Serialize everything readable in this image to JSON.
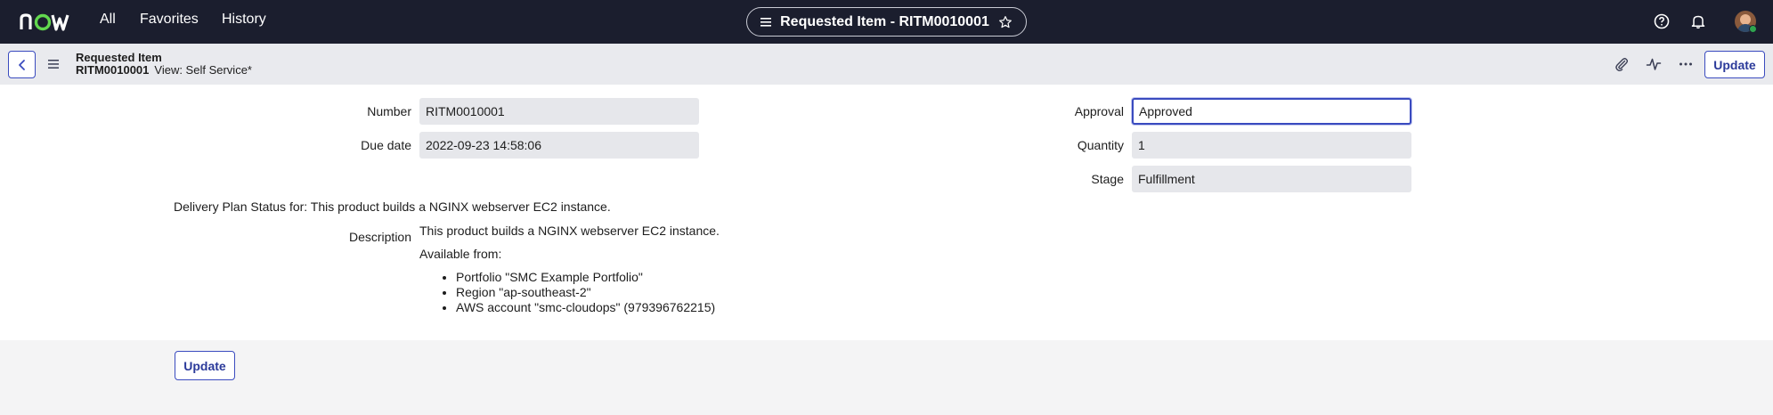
{
  "nav": {
    "links": {
      "all": "All",
      "favorites": "Favorites",
      "history": "History"
    },
    "center_title": "Requested Item - RITM0010001",
    "icons": [
      "help-icon",
      "bell-icon",
      "avatar"
    ]
  },
  "form_header": {
    "type": "Requested Item",
    "number": "RITM0010001",
    "view": "View: Self Service*",
    "update_label": "Update",
    "icons": [
      "paperclip-icon",
      "activity-icon",
      "more-icon"
    ]
  },
  "fields": {
    "number": {
      "label": "Number",
      "value": "RITM0010001"
    },
    "due_date": {
      "label": "Due date",
      "value": "2022-09-23 14:58:06"
    },
    "approval": {
      "label": "Approval",
      "value": "Approved"
    },
    "quantity": {
      "label": "Quantity",
      "value": "1"
    },
    "stage": {
      "label": "Stage",
      "value": "Fulfillment"
    }
  },
  "delivery_plan": "Delivery Plan Status for: This product builds a NGINX webserver EC2 instance.",
  "description": {
    "label": "Description",
    "line1": "This product builds a NGINX webserver EC2 instance.",
    "line2": "Available from:",
    "items": [
      "Portfolio \"SMC Example Portfolio\"",
      "Region \"ap-southeast-2\"",
      "AWS account \"smc-cloudops\" (979396762215)"
    ]
  },
  "footer": {
    "update_label": "Update"
  },
  "colors": {
    "nav_bg": "#1b1e2e",
    "accent": "#3a4bbf",
    "logo_green": "#62d84e"
  }
}
